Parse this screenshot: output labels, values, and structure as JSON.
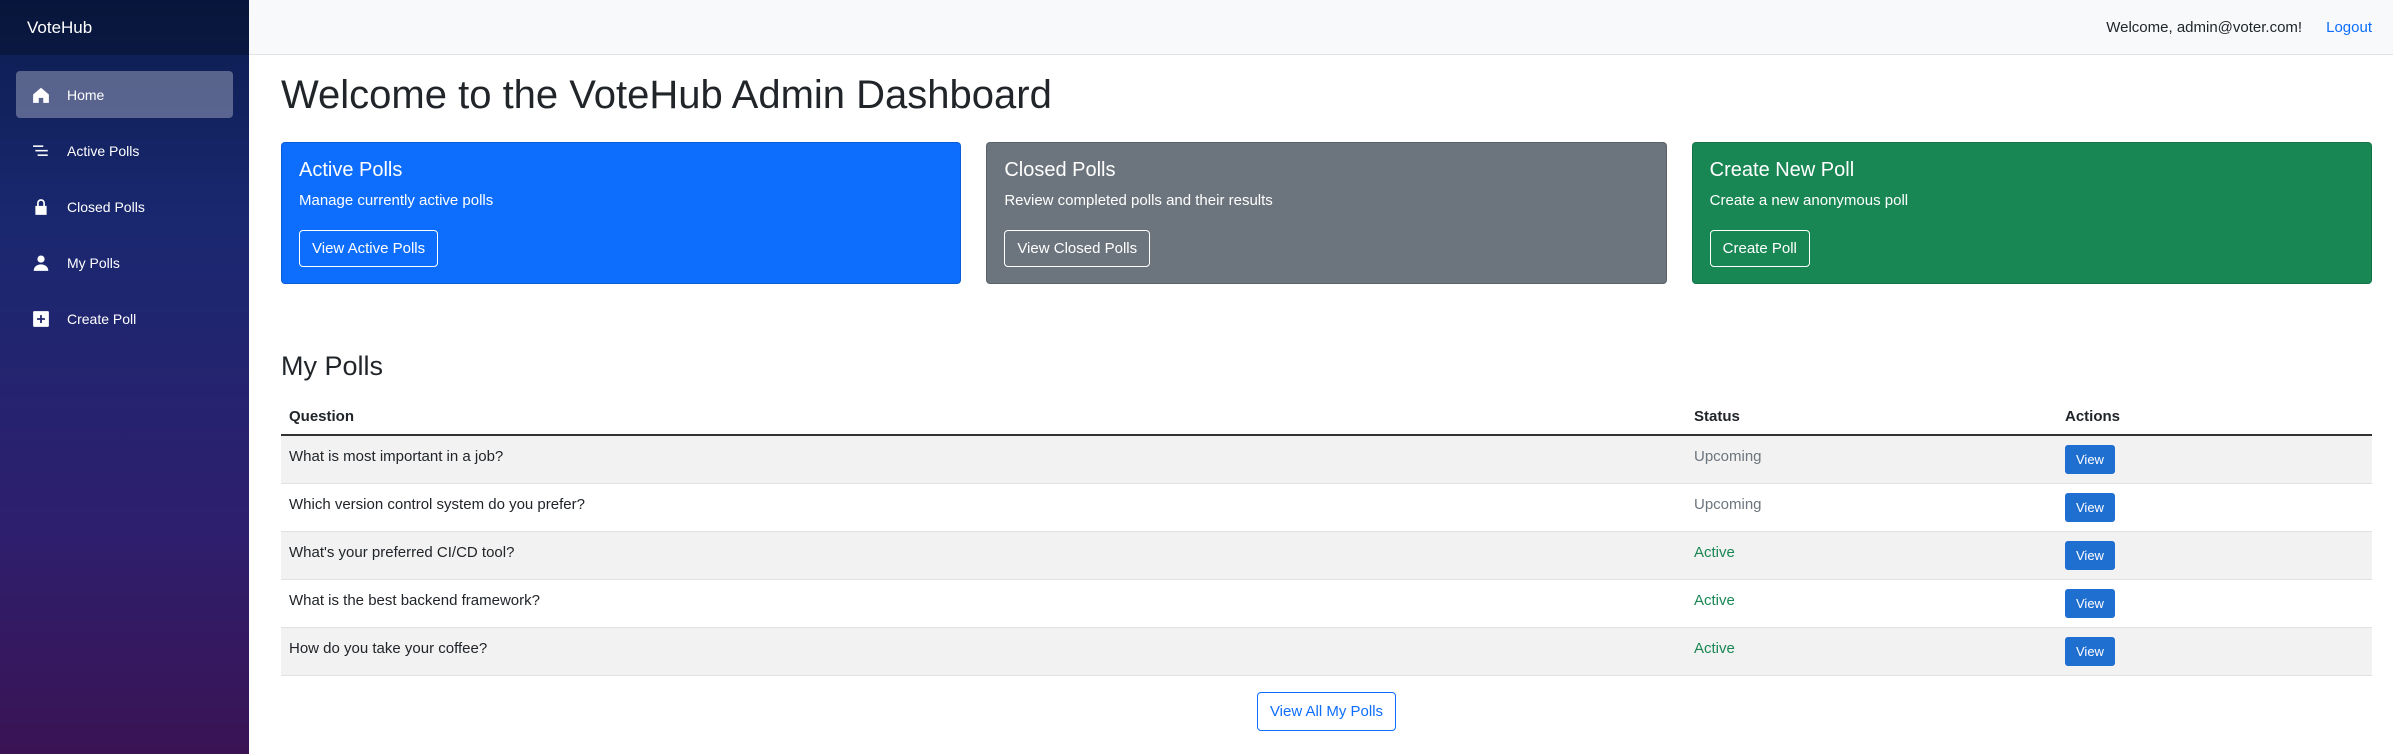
{
  "brand": "VoteHub",
  "sidebar": {
    "items": [
      {
        "label": "Home",
        "icon": "home-icon"
      },
      {
        "label": "Active Polls",
        "icon": "list-icon"
      },
      {
        "label": "Closed Polls",
        "icon": "lock-icon"
      },
      {
        "label": "My Polls",
        "icon": "person-icon"
      },
      {
        "label": "Create Poll",
        "icon": "plus-square-icon"
      }
    ]
  },
  "topbar": {
    "welcome": "Welcome, admin@voter.com!",
    "logout": "Logout"
  },
  "page_title": "Welcome to the VoteHub Admin Dashboard",
  "cards": [
    {
      "title": "Active Polls",
      "text": "Manage currently active polls",
      "button": "View Active Polls",
      "color": "#0d6efd"
    },
    {
      "title": "Closed Polls",
      "text": "Review completed polls and their results",
      "button": "View Closed Polls",
      "color": "#6c757d"
    },
    {
      "title": "Create New Poll",
      "text": "Create a new anonymous poll",
      "button": "Create Poll",
      "color": "#198754"
    }
  ],
  "my_polls": {
    "title": "My Polls",
    "columns": [
      "Question",
      "Status",
      "Actions"
    ],
    "rows": [
      {
        "question": "What is most important in a job?",
        "status": "Upcoming",
        "action": "View"
      },
      {
        "question": "Which version control system do you prefer?",
        "status": "Upcoming",
        "action": "View"
      },
      {
        "question": "What's your preferred CI/CD tool?",
        "status": "Active",
        "action": "View"
      },
      {
        "question": "What is the best backend framework?",
        "status": "Active",
        "action": "View"
      },
      {
        "question": "How do you take your coffee?",
        "status": "Active",
        "action": "View"
      }
    ],
    "view_all": "View All My Polls"
  }
}
